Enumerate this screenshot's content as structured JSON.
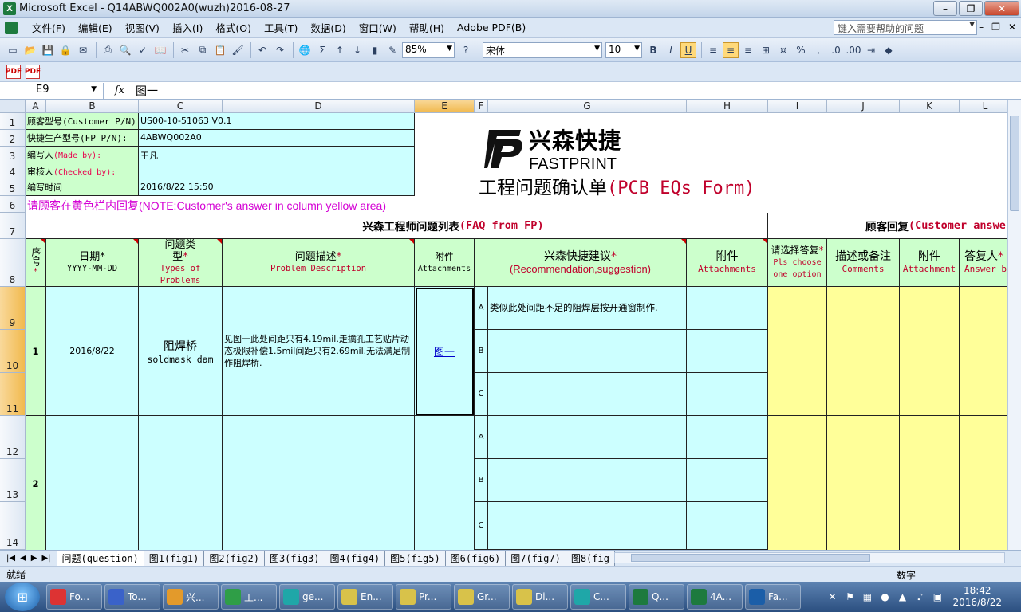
{
  "window": {
    "title": "Microsoft Excel - Q14ABWQ002A0(wuzh)2016-08-27",
    "app_icon": "X"
  },
  "menu": [
    "文件(F)",
    "编辑(E)",
    "视图(V)",
    "插入(I)",
    "格式(O)",
    "工具(T)",
    "数据(D)",
    "窗口(W)",
    "帮助(H)",
    "Adobe PDF(B)"
  ],
  "help_box": "键入需要帮助的问题",
  "toolbar": {
    "zoom": "85%",
    "font": "宋体",
    "font_size": "10"
  },
  "formula": {
    "namebox": "E9",
    "fx": "fx",
    "value": "图一"
  },
  "columns": [
    "A",
    "B",
    "C",
    "D",
    "E",
    "F",
    "G",
    "H",
    "I",
    "J",
    "K",
    "L"
  ],
  "rows": [
    "1",
    "2",
    "3",
    "4",
    "5",
    "6",
    "7",
    "8",
    "9",
    "10",
    "11",
    "12",
    "13",
    "14"
  ],
  "info": {
    "labels": [
      "顾客型号",
      "快捷生产型号",
      "编写人",
      "审核人",
      "编写时间"
    ],
    "labels_en": [
      "(Customer P/N):",
      "(FP P/N):",
      "(Made by):",
      "(Checked by):",
      ""
    ],
    "values": [
      "US00-10-51063 V0.1",
      "4ABWQ002A0",
      "王凡",
      "",
      "2016/8/22 15:50"
    ]
  },
  "logo": {
    "zh": "兴森快捷",
    "en": "FASTPRINT"
  },
  "form_title": {
    "zh": "工程问题确认单",
    "en": "(PCB EQs Form)"
  },
  "note": "请顾客在黄色栏内回复(NOTE:Customer's answer in column yellow area)",
  "sections": {
    "fp": {
      "zh": "兴森工程师问题列表",
      "en": "(FAQ from FP)"
    },
    "customer": {
      "zh": "顾客回复",
      "en": "(Customer answe"
    }
  },
  "headers": {
    "seq": {
      "zh": "序号",
      "star": "*"
    },
    "date": {
      "zh": "日期*",
      "en": "YYYY-MM-DD"
    },
    "type": {
      "zh": "问题类型",
      "star": "*",
      "en": "Types of Problems"
    },
    "desc": {
      "zh": "问题描述",
      "star": "*",
      "en": "Problem Description"
    },
    "attach": {
      "zh": "附件",
      "en": "Attachments"
    },
    "suggest": {
      "zh": "兴森快捷建议",
      "star": "*",
      "en": "(Recommendation,suggestion)"
    },
    "attach2": {
      "zh": "附件",
      "en": "Attachments"
    },
    "choose": {
      "zh": "请选择答复",
      "star": "*",
      "en": "Pls choose one option"
    },
    "comments": {
      "zh": "描述或备注",
      "en": "Comments"
    },
    "attach3": {
      "zh": "附件",
      "en": "Attachment"
    },
    "answer_by": {
      "zh": "答复人",
      "star": "*",
      "en": "Answer by"
    }
  },
  "rows_data": [
    {
      "no": "1",
      "date": "2016/8/22",
      "type_zh": "阻焊桥",
      "type_en": "soldmask dam",
      "desc": "见图一此处间距只有4.19mil.走擒孔工艺贴片动态极限补偿1.5mil间距只有2.69mil.无法满足制作阻焊桥.",
      "attach": "图一",
      "options": [
        {
          "letter": "A",
          "text": "类似此处间距不足的阻焊层按开通窗制作."
        },
        {
          "letter": "B",
          "text": ""
        },
        {
          "letter": "C",
          "text": ""
        }
      ]
    },
    {
      "no": "2",
      "date": "",
      "type_zh": "",
      "type_en": "",
      "desc": "",
      "attach": "",
      "options": [
        {
          "letter": "A",
          "text": ""
        },
        {
          "letter": "B",
          "text": ""
        },
        {
          "letter": "C",
          "text": ""
        }
      ]
    }
  ],
  "sheets": [
    "问题(question)",
    "图1(fig1)",
    "图2(fig2)",
    "图3(fig3)",
    "图4(fig4)",
    "图5(fig5)",
    "图6(fig6)",
    "图7(fig7)",
    "图8(fig"
  ],
  "status": {
    "ready": "就绪",
    "mode": "数字"
  },
  "taskbar": {
    "tasks": [
      "Fo...",
      "To...",
      "兴...",
      "工...",
      "ge...",
      "En...",
      "Pr...",
      "Gr...",
      "Di...",
      "C...",
      "Q...",
      "4A...",
      "Fa..."
    ],
    "time": "18:42",
    "date": "2016/8/22"
  },
  "colors": {
    "label_green": "#ccffcc",
    "value_cyan": "#ccffff",
    "answer_yellow": "#ffff99",
    "accent_red": "#c0002b"
  }
}
